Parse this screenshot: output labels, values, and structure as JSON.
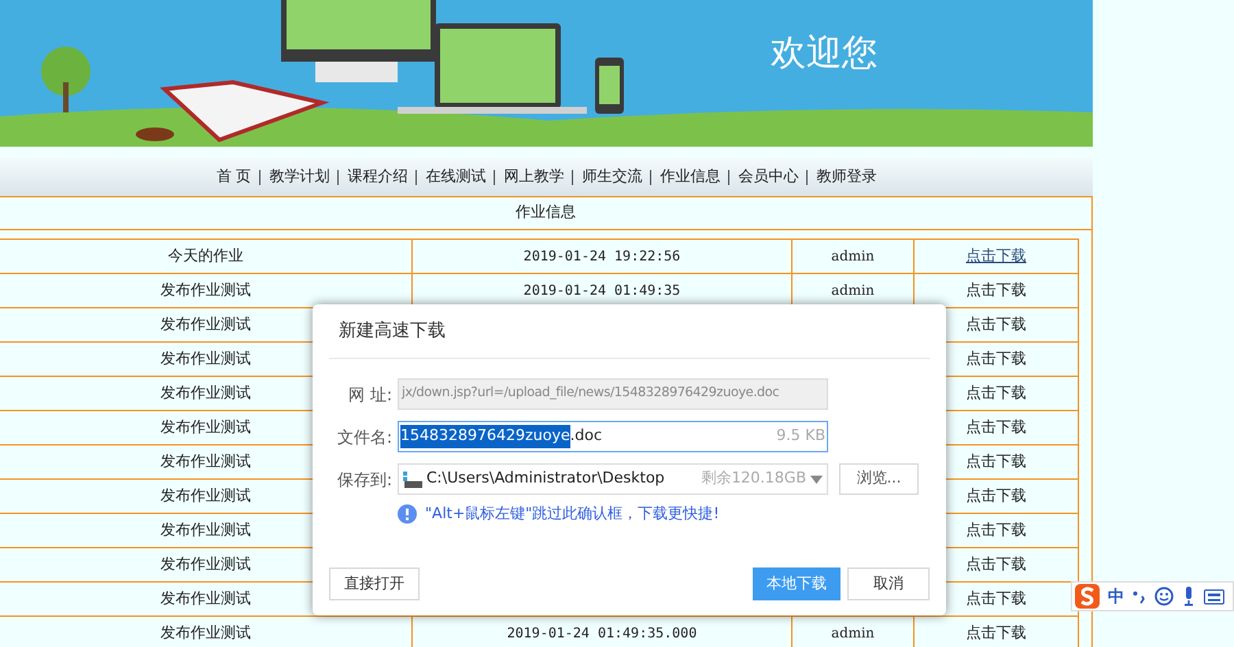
{
  "banner": {
    "welcome": "欢迎您"
  },
  "nav": {
    "items": [
      "首 页",
      "教学计划",
      "课程介绍",
      "在线测试",
      "网上教学",
      "师生交流",
      "作业信息",
      "会员中心",
      "教师登录"
    ]
  },
  "panel": {
    "title": "作业信息"
  },
  "table": {
    "rows": [
      {
        "title": "今天的作业",
        "date": "2019-01-24 19:22:56",
        "author": "admin",
        "link": "点击下载",
        "hovered": true
      },
      {
        "title": "发布作业测试",
        "date": "2019-01-24 01:49:35",
        "author": "admin",
        "link": "点击下载",
        "hovered": false
      },
      {
        "title": "发布作业测试",
        "link": "点击下载",
        "hovered": false
      },
      {
        "title": "发布作业测试",
        "link": "点击下载",
        "hovered": false
      },
      {
        "title": "发布作业测试",
        "link": "点击下载",
        "hovered": false
      },
      {
        "title": "发布作业测试",
        "link": "点击下载",
        "hovered": false
      },
      {
        "title": "发布作业测试",
        "link": "点击下载",
        "hovered": false
      },
      {
        "title": "发布作业测试",
        "link": "点击下载",
        "hovered": false
      },
      {
        "title": "发布作业测试",
        "link": "点击下载",
        "hovered": false
      },
      {
        "title": "发布作业测试",
        "link": "点击下载",
        "hovered": false
      },
      {
        "title": "发布作业测试",
        "link": "点击下载",
        "hovered": false
      },
      {
        "title": "发布作业测试",
        "date": "2019-01-24 01:49:35.000",
        "author": "admin",
        "link": "点击下载",
        "hovered": false
      }
    ]
  },
  "dialog": {
    "title": "新建高速下载",
    "url_label": "网 址:",
    "url": "jx/down.jsp?url=/upload_file/news/1548328976429zuoye.doc",
    "name_label": "文件名:",
    "name_selected": "1548328976429zuoye",
    "name_rest": ".doc",
    "size": "9.5 KB",
    "save_label": "保存到:",
    "path": "C:\\Users\\Administrator\\Desktop",
    "free": "剩余120.18GB",
    "browse": "浏览...",
    "hint": "\"Alt+鼠标左键\"跳过此确认框，下载更快捷!",
    "buttons": [
      {
        "label": "直接打开",
        "kind": "plain"
      },
      {
        "label": "本地下载",
        "kind": "primary"
      },
      {
        "label": "取消",
        "kind": "plain"
      }
    ]
  },
  "ime": {
    "mode": "中"
  }
}
